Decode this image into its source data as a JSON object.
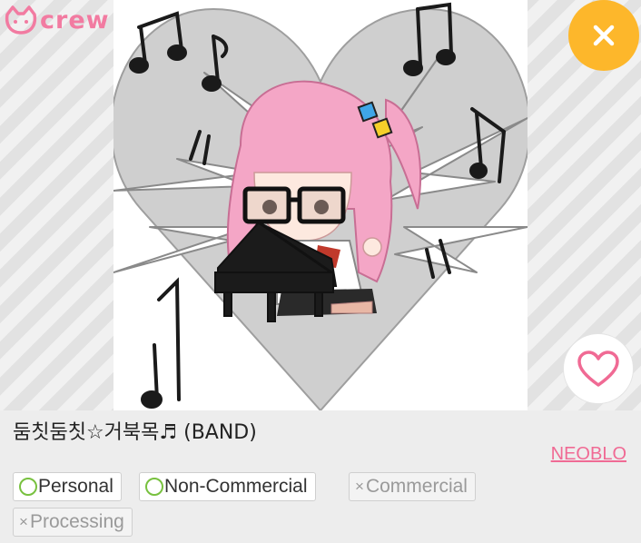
{
  "header": {
    "logo_text": "crew",
    "logo_icon": "cat-face-icon"
  },
  "actions": {
    "close_icon": "close-icon",
    "like_icon": "heart-icon"
  },
  "artwork": {
    "icon": "artwork-image"
  },
  "item": {
    "title": "둠칫둠칫☆거북목♬ (BAND)",
    "author": "NEOBLO"
  },
  "license_tags": [
    {
      "label": "Personal",
      "allowed": true
    },
    {
      "label": "Non-Commercial",
      "allowed": true
    },
    {
      "label": "Commercial",
      "allowed": false
    },
    {
      "label": "Processing",
      "allowed": false
    }
  ],
  "marks": {
    "allowed": "",
    "not_allowed": "×"
  },
  "colors": {
    "accent": "#fdb72b",
    "brand_pink": "#f27ba1",
    "allowed_green": "#78c13f"
  }
}
